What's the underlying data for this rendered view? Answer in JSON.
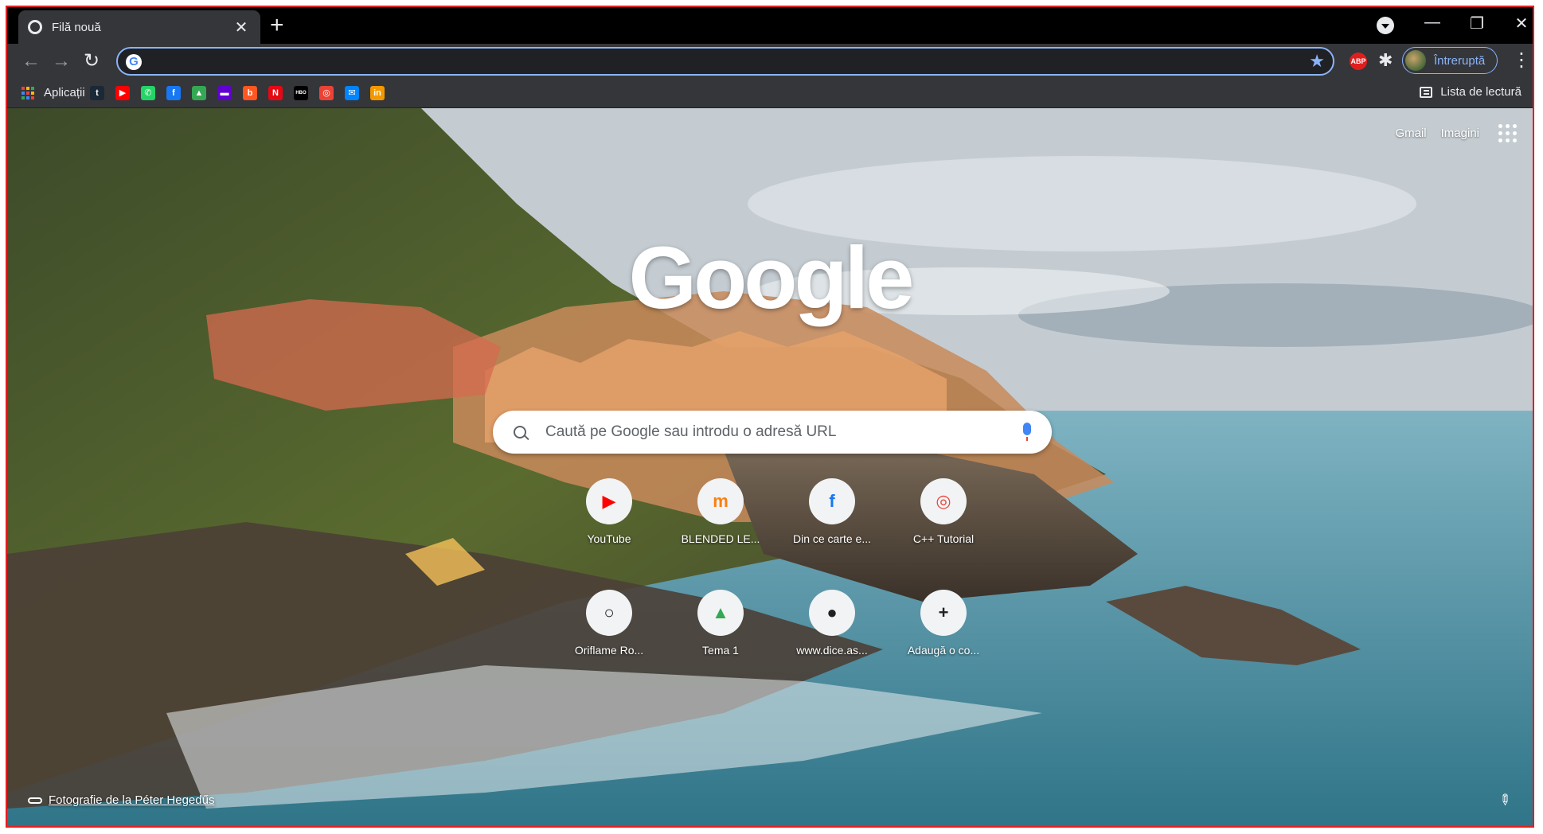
{
  "tab": {
    "title": "Filă nouă",
    "close": "✕",
    "new_tab": "+"
  },
  "window_controls": {
    "minimize": "—",
    "restore": "❐",
    "close": "✕"
  },
  "toolbar": {
    "back": "←",
    "forward": "→",
    "reload": "↻",
    "omnibox_value": "",
    "omnibox_g": "G",
    "bookmark_star": "★",
    "abp_label": "ABP",
    "extensions": "✱",
    "pause_label": "Întreruptă",
    "menu": "⋮"
  },
  "bookmarks": {
    "apps_label": "Aplicații",
    "items": [
      {
        "icon": "tumblr-icon",
        "glyph": "t",
        "color": "#1b2836"
      },
      {
        "icon": "youtube-icon",
        "glyph": "▶",
        "color": "#ff0000"
      },
      {
        "icon": "whatsapp-icon",
        "glyph": "✆",
        "color": "#25d366"
      },
      {
        "icon": "facebook-icon",
        "glyph": "f",
        "color": "#1877f2"
      },
      {
        "icon": "google-drive-icon",
        "glyph": "▲",
        "color": "#34a853"
      },
      {
        "icon": "yahoo-icon",
        "glyph": "▬",
        "color": "#6001d2"
      },
      {
        "icon": "blogger-icon",
        "glyph": "b",
        "color": "#ff5722"
      },
      {
        "icon": "netflix-icon",
        "glyph": "N",
        "color": "#e50914"
      },
      {
        "icon": "hbo-go-icon",
        "glyph": "HBO",
        "color": "#000000"
      },
      {
        "icon": "chrome-ring-icon",
        "glyph": "◎",
        "color": "#ea4335"
      },
      {
        "icon": "messenger-icon",
        "glyph": "✉",
        "color": "#0084ff"
      },
      {
        "icon": "in-icon",
        "glyph": "in",
        "color": "#f29900"
      }
    ],
    "reading_list": "Lista de lectură"
  },
  "content": {
    "links": {
      "gmail": "Gmail",
      "images": "Imagini"
    },
    "logo": "Google",
    "search_placeholder": "Caută pe Google sau introdu o adresă URL",
    "tiles": [
      {
        "label": "YouTube",
        "icon": "youtube-icon",
        "glyph": "▶",
        "color": "#ff0000"
      },
      {
        "label": "BLENDED LE...",
        "icon": "moodle-icon",
        "glyph": "m",
        "color": "#f98012"
      },
      {
        "label": "Din ce carte e...",
        "icon": "facebook-icon",
        "glyph": "f",
        "color": "#1877f2"
      },
      {
        "label": "C++ Tutorial",
        "icon": "w3schools-icon",
        "glyph": "◎",
        "color": "#e8453c"
      },
      {
        "label": "Oriflame Ro...",
        "icon": "oriflame-icon",
        "glyph": "○",
        "color": "#202124"
      },
      {
        "label": "Tema 1",
        "icon": "google-drive-icon",
        "glyph": "▲",
        "color": "#34a853"
      },
      {
        "label": "www.dice.as...",
        "icon": "github-icon",
        "glyph": "●",
        "color": "#202124"
      },
      {
        "label": "Adaugă o co...",
        "icon": "plus-icon",
        "glyph": "+",
        "color": "#202124"
      }
    ],
    "attribution": "Fotografie de la Péter Hegedűs",
    "customize": "✎"
  }
}
